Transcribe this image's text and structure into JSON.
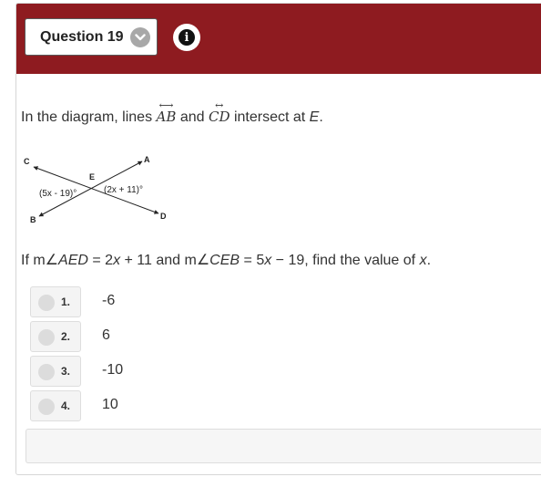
{
  "header": {
    "question_label": "Question 19",
    "chevron_icon": "chevron-down-icon",
    "info_icon": "info-icon",
    "info_glyph": "i",
    "brand_color": "#8e1b20"
  },
  "prompt": {
    "pre": "In the diagram, lines ",
    "line1": "AB",
    "mid": " and ",
    "line2": "CD",
    "post": " intersect at ",
    "point": "E",
    "end": "."
  },
  "diagram": {
    "labels": {
      "A": "A",
      "B": "B",
      "C": "C",
      "D": "D",
      "E": "E"
    },
    "angle_left": "(5x - 19)°",
    "angle_right": "(2x + 11)°"
  },
  "question": {
    "p1": "If m∠",
    "a1": "AED",
    "p2": " = 2",
    "x1": "x",
    "p3": " + 11 and m∠",
    "a2": "CEB",
    "p4": " = 5",
    "x2": "x",
    "p5": " − 19, find the value of ",
    "x3": "x",
    "p6": "."
  },
  "choices": [
    {
      "num": "1.",
      "value": "-6"
    },
    {
      "num": "2.",
      "value": "6"
    },
    {
      "num": "3.",
      "value": "-10"
    },
    {
      "num": "4.",
      "value": "10"
    }
  ]
}
